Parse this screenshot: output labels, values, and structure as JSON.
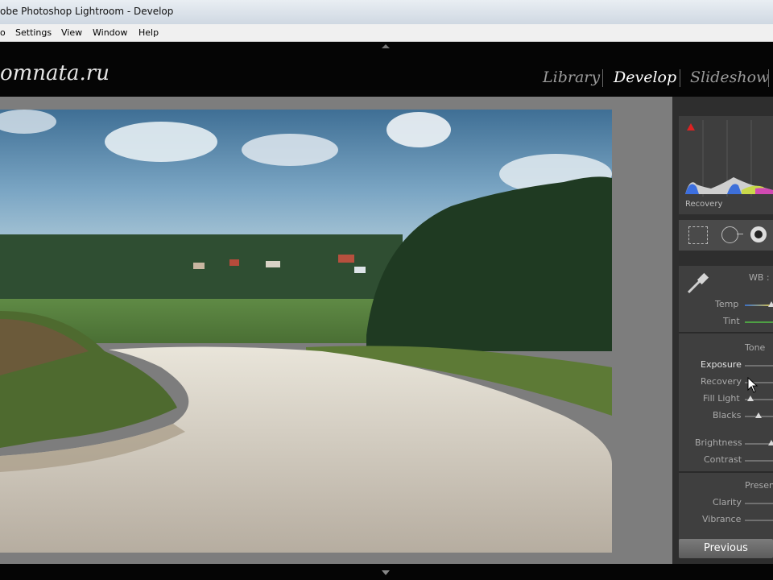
{
  "window": {
    "title": "obe Photoshop Lightroom - Develop"
  },
  "menu": [
    "o",
    "Settings",
    "View",
    "Window",
    "Help"
  ],
  "identity_plate": "omnata.ru",
  "modules": [
    "Library",
    "Develop",
    "Slideshow"
  ],
  "active_module": "Develop",
  "histogram": {
    "label": "Recovery"
  },
  "basic_panel": {
    "wb_label": "WB :",
    "temp_label": "Temp",
    "tint_label": "Tint",
    "tone_label": "Tone",
    "exposure_label": "Exposure",
    "recovery_label": "Recovery",
    "fill_light_label": "Fill Light",
    "blacks_label": "Blacks",
    "brightness_label": "Brightness",
    "contrast_label": "Contrast",
    "presence_label": "Presen",
    "clarity_label": "Clarity",
    "vibrance_label": "Vibrance"
  },
  "buttons": {
    "previous": "Previous"
  },
  "colors": {
    "accent_text": "#ffffff",
    "inactive_module": "#9a9a9a",
    "panel_bg": "#3f3f3f"
  },
  "icons": [
    "crop-overlay-icon",
    "spot-removal-icon",
    "red-eye-icon",
    "eyedropper-icon",
    "clipping-warning-icon"
  ]
}
